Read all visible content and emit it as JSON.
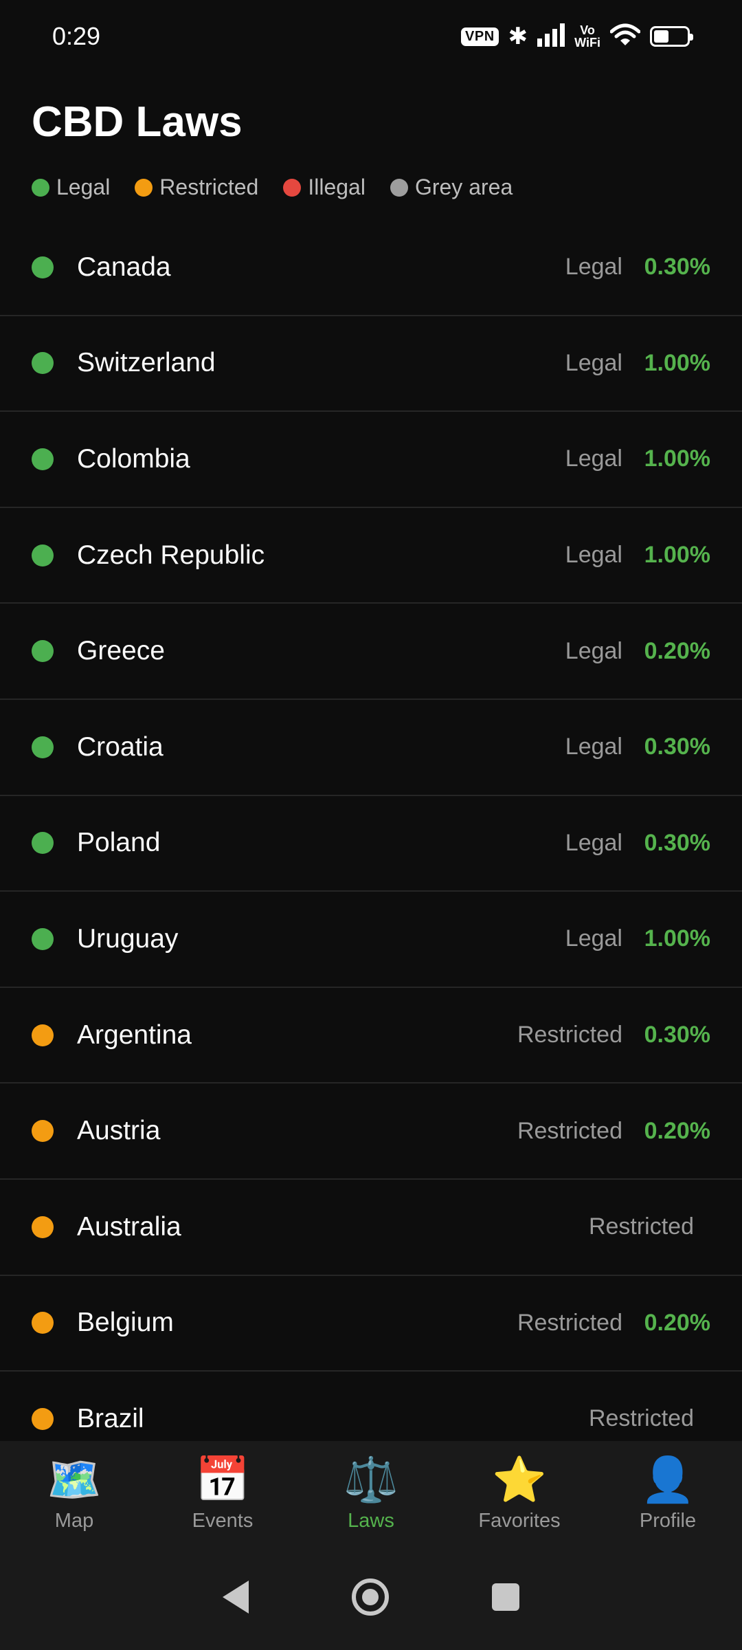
{
  "status_bar": {
    "time": "0:29",
    "vpn": "VPN",
    "vowifi_top": "Vo",
    "vowifi_bottom": "WiFi",
    "icons": [
      "bluetooth-icon",
      "signal-icon",
      "wifi-icon",
      "battery-icon"
    ]
  },
  "page": {
    "title": "CBD Laws"
  },
  "colors": {
    "Legal": "#4caf50",
    "Restricted": "#f39c12",
    "Illegal": "#e5483f",
    "Grey area": "#9e9e9e",
    "thc": "#55b34d",
    "active_tab": "#55b34d"
  },
  "legend": [
    {
      "label": "Legal",
      "status": "Legal"
    },
    {
      "label": "Restricted",
      "status": "Restricted"
    },
    {
      "label": "Illegal",
      "status": "Illegal"
    },
    {
      "label": "Grey area",
      "status": "Grey area"
    }
  ],
  "countries": [
    {
      "name": "Canada",
      "status": "Legal",
      "thc": "0.30%"
    },
    {
      "name": "Switzerland",
      "status": "Legal",
      "thc": "1.00%"
    },
    {
      "name": "Colombia",
      "status": "Legal",
      "thc": "1.00%"
    },
    {
      "name": "Czech Republic",
      "status": "Legal",
      "thc": "1.00%"
    },
    {
      "name": "Greece",
      "status": "Legal",
      "thc": "0.20%"
    },
    {
      "name": "Croatia",
      "status": "Legal",
      "thc": "0.30%"
    },
    {
      "name": "Poland",
      "status": "Legal",
      "thc": "0.30%"
    },
    {
      "name": "Uruguay",
      "status": "Legal",
      "thc": "1.00%"
    },
    {
      "name": "Argentina",
      "status": "Restricted",
      "thc": "0.30%"
    },
    {
      "name": "Austria",
      "status": "Restricted",
      "thc": "0.20%"
    },
    {
      "name": "Australia",
      "status": "Restricted",
      "thc": ""
    },
    {
      "name": "Belgium",
      "status": "Restricted",
      "thc": "0.20%"
    },
    {
      "name": "Brazil",
      "status": "Restricted",
      "thc": ""
    }
  ],
  "bottom_nav": {
    "items": [
      {
        "label": "Map",
        "icon": "map-icon",
        "glyph": "🗺️",
        "active": false
      },
      {
        "label": "Events",
        "icon": "calendar-icon",
        "glyph": "📅",
        "active": false
      },
      {
        "label": "Laws",
        "icon": "scales-icon",
        "glyph": "⚖️",
        "active": true
      },
      {
        "label": "Favorites",
        "icon": "star-icon",
        "glyph": "⭐",
        "active": false
      },
      {
        "label": "Profile",
        "icon": "profile-icon",
        "glyph": "👤",
        "active": false
      }
    ]
  },
  "system_nav": [
    "back-icon",
    "home-icon",
    "recents-icon"
  ]
}
